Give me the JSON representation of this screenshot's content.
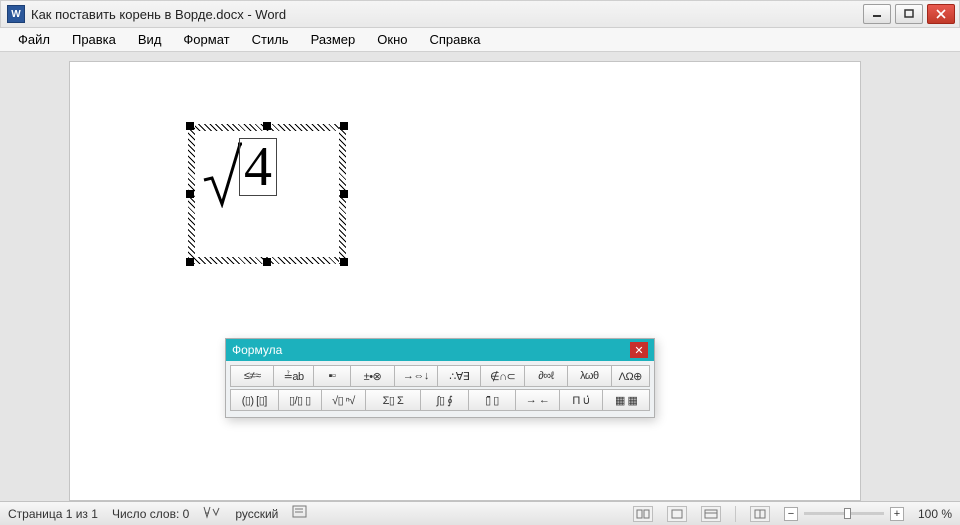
{
  "titlebar": {
    "title": "Как поставить корень в Ворде.docx - Word"
  },
  "menubar": {
    "items": [
      "Файл",
      "Правка",
      "Вид",
      "Формат",
      "Стиль",
      "Размер",
      "Окно",
      "Справка"
    ]
  },
  "equation": {
    "radicand": "4"
  },
  "formula_panel": {
    "title": "Формула",
    "row1": [
      "≤≠≈",
      "≟ab",
      "▪▫",
      "±•⊗",
      "→⇔↓",
      "∴∀∃",
      "∉∩⊂",
      "∂∞ℓ",
      "λωθ",
      "ΛΩ⊕"
    ],
    "row2": [
      "(▯) [▯]",
      "▯/▯ ▯",
      "√▯ ⁿ√",
      "Σ▯ Σ",
      "∫▯ ∮",
      "▯̄ ▯",
      "→ ←",
      "Π ∪̇",
      "▦ ▦"
    ]
  },
  "statusbar": {
    "page": "Страница 1 из 1",
    "words": "Число слов: 0",
    "lang": "русский",
    "zoom": "100 %"
  }
}
